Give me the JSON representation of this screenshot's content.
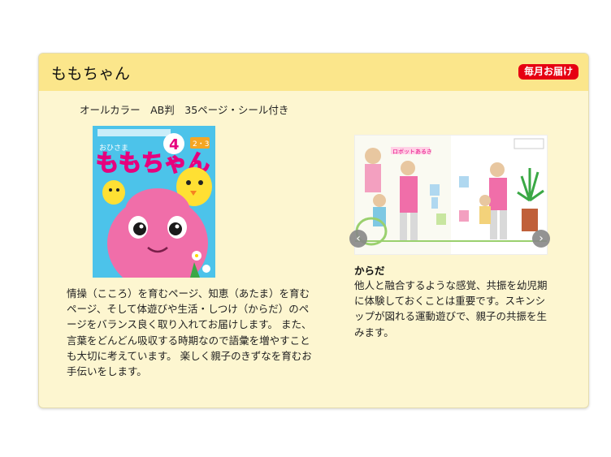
{
  "card": {
    "title": "ももちゃん",
    "badge": "毎月お届け",
    "specs": "オールカラー　AB判　35ページ・シール付き",
    "description": "情操（こころ）を育むページ、知恵（あたま）を育むページ、そして体遊びや生活・しつけ（からだ）のページをバランス良く取り入れてお届けします。 また、言葉をどんどん吸収する時期なので語彙を増やすことも大切に考えています。 楽しく親子のきずなを育むお手伝いをします。",
    "cover": {
      "issue": "4",
      "small_label": "おひさま",
      "age_tag": "2・3",
      "title_art": "ももちゃん"
    },
    "carousel": {
      "prev_icon": "chevron-left-icon",
      "next_icon": "chevron-right-icon",
      "image_caption": "ロボットあるき"
    },
    "section": {
      "title": "からだ",
      "body": "他人と融合するような感覚、共振を幼児期に体験しておくことは重要です。スキンシップが図れる運動遊びで、親子の共振を生みます。"
    }
  },
  "colors": {
    "header": "#fbe68b",
    "card_bg": "#fdf6d0",
    "badge": "#e60012",
    "cover_bg": "#4cc3ea",
    "character_pink": "#f06ea9"
  }
}
